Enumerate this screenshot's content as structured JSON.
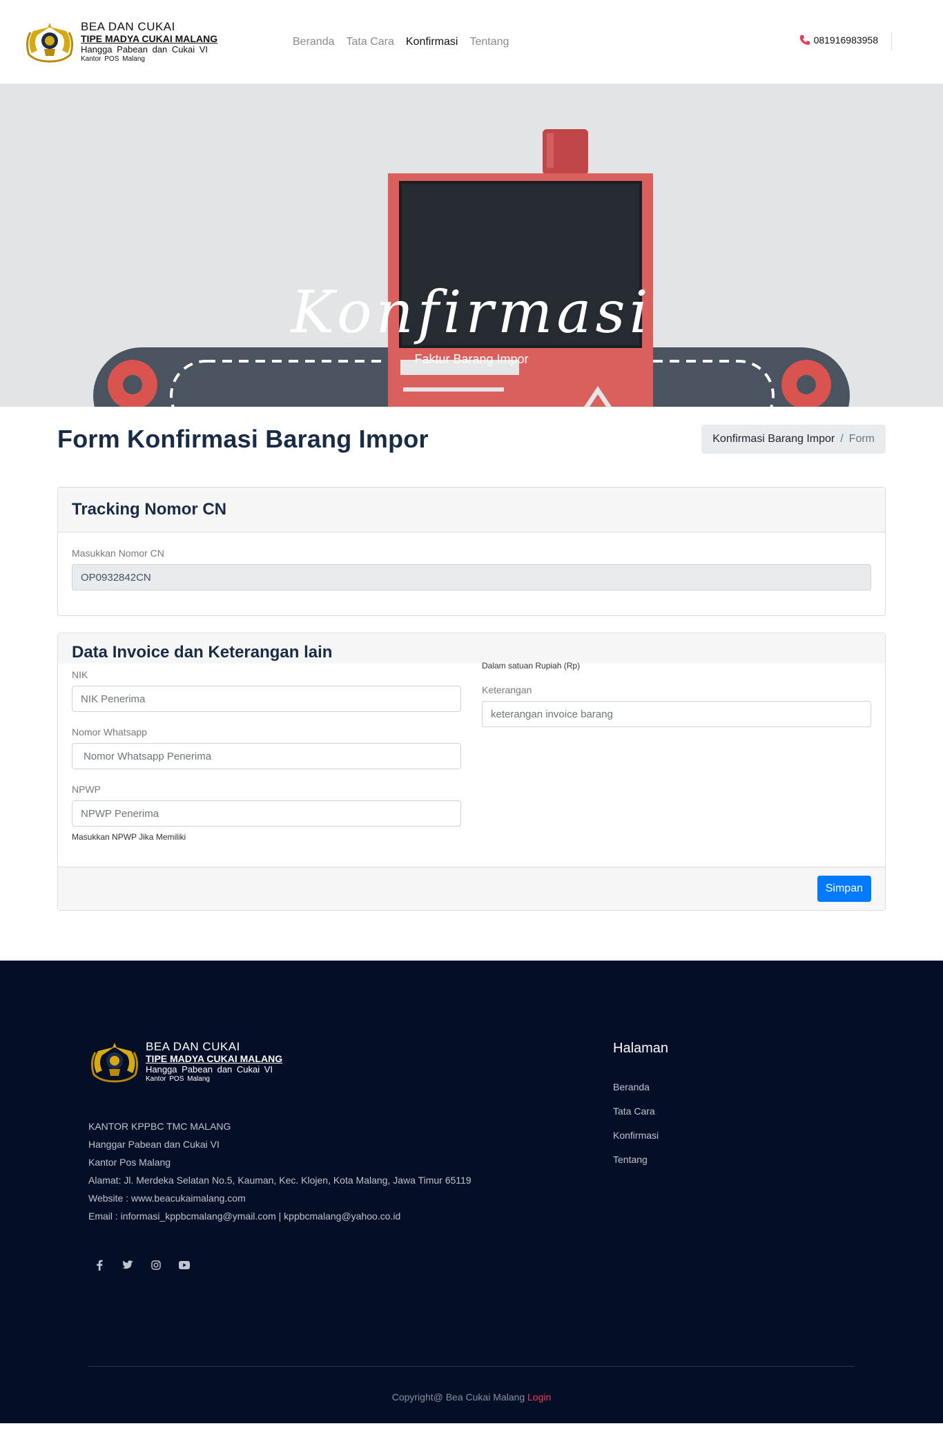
{
  "brand": {
    "line1": "BEA  DAN  CUKAI",
    "line2": "TIPE MADYA CUKAI MALANG",
    "line3": "Hangga  Pabean  dan  Cukai  VI",
    "line4": "Kantor  POS  Malang"
  },
  "nav": {
    "items": [
      {
        "label": "Beranda"
      },
      {
        "label": "Tata Cara"
      },
      {
        "label": "Konfirmasi"
      },
      {
        "label": "Tentang"
      }
    ],
    "active": "Konfirmasi",
    "phone": "081916983958"
  },
  "hero": {
    "title": "Konfirmasi",
    "subtitle": "Faktur Barang Impor"
  },
  "page": {
    "title": "Form Konfirmasi Barang Impor",
    "breadcrumb": [
      "Konfirmasi Barang Impor",
      "Form"
    ],
    "breadcrumb_sep": "/"
  },
  "tracking": {
    "title": "Tracking Nomor CN",
    "label": "Masukkan Nomor CN",
    "value": "OP0932842CN"
  },
  "invoice": {
    "title": "Data Invoice dan Keterangan lain",
    "nik_label": "NIK",
    "nik_placeholder": "NIK Penerima",
    "wa_label": "Nomor Whatsapp",
    "wa_placeholder": "Nomor Whatsapp Penerima",
    "npwp_label": "NPWP",
    "npwp_placeholder": "NPWP Penerima",
    "npwp_hint": "Masukkan NPWP Jika Memiliki",
    "rupiah_hint": "Dalam satuan Rupiah (Rp)",
    "ket_label": "Keterangan",
    "ket_placeholder": "keterangan invoice barang",
    "submit": "Simpan"
  },
  "footer": {
    "address": [
      "KANTOR KPPBC TMC MALANG",
      "Hanggar Pabean dan Cukai VI",
      "Kantor Pos Malang",
      "Alamat: Jl. Merdeka Selatan No.5, Kauman, Kec. Klojen, Kota Malang, Jawa Timur 65119",
      "Website : www.beacukaimalang.com",
      "Email : informasi_kppbcmalang@ymail.com | kppbcmalang@yahoo.co.id"
    ],
    "pages_title": "Halaman",
    "pages": [
      "Beranda",
      "Tata Cara",
      "Konfirmasi",
      "Tentang"
    ],
    "socials": [
      "facebook-icon",
      "twitter-icon",
      "instagram-icon",
      "youtube-icon"
    ],
    "copyright": "Copyright@ Bea Cukai Malang",
    "login": "Login"
  },
  "colors": {
    "primary": "#007bff",
    "footer_bg": "#050e27",
    "heading": "#1a2b47",
    "phone_icon": "#e83e5a",
    "login_link": "#e83e5a"
  }
}
